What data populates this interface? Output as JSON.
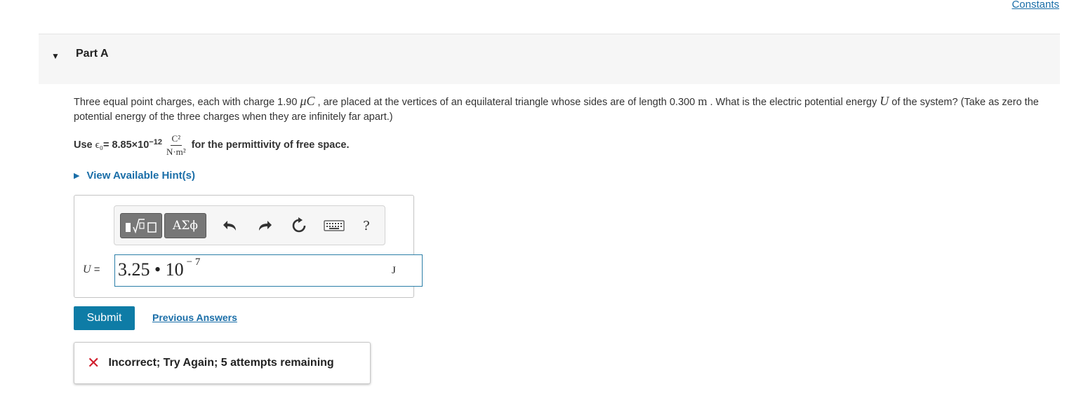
{
  "header": {
    "constants_link": "Constants"
  },
  "part": {
    "title": "Part A"
  },
  "problem": {
    "text_1": "Three equal point charges, each with charge 1.90 ",
    "charge_unit": "μC",
    "text_2": " , are placed at the vertices of an equilateral triangle whose sides are of length 0.300 ",
    "length_unit": "m",
    "text_3": " . What is the electric potential energy ",
    "symbol_u": "U",
    "text_4": " of the system? (Take as zero the potential energy of the three charges when they are infinitely far apart.)"
  },
  "permittivity": {
    "prefix": "Use ",
    "symbol": "ϵ₀",
    "value": " = 8.85×10",
    "exponent": "−12",
    "unit_numerator": "C²",
    "unit_denominator": "N·m²",
    "suffix": "for the permittivity of free space."
  },
  "hints": {
    "label": "View Available Hint(s)"
  },
  "toolbar": {
    "greek_label": "ΑΣϕ",
    "help_label": "?"
  },
  "answer": {
    "label_symbol": "U",
    "label_equals": " =",
    "value_mantissa": "3.25 • 10",
    "value_exponent": "− 7",
    "unit": "J"
  },
  "actions": {
    "submit_label": "Submit",
    "previous_answers_label": "Previous Answers"
  },
  "feedback": {
    "message": "Incorrect; Try Again; 5 attempts remaining",
    "status_color": "#d1202e"
  },
  "colors": {
    "accent": "#0e7ca6",
    "link": "#1a6ea8"
  }
}
